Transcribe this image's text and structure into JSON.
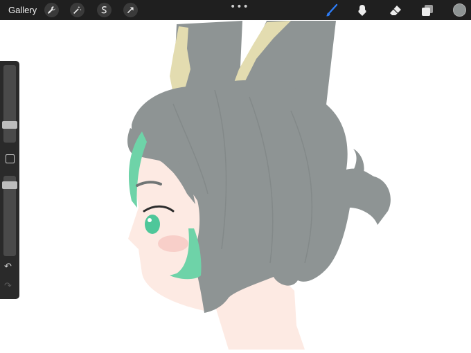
{
  "topbar": {
    "gallery_label": "Gallery",
    "more_label": "•••",
    "left_tools": [
      "wrench-icon",
      "magic-wand-icon",
      "selection-icon",
      "transform-arrow-icon"
    ],
    "right_tools": [
      "brush-icon",
      "smudge-icon",
      "eraser-icon",
      "layers-icon"
    ],
    "active_tool": "brush",
    "accent_color": "#2d7cf6",
    "current_color": "#8e9494"
  },
  "sidebar": {
    "brush_size_level": 0.2,
    "opacity_level": 0.92,
    "undo_icon": "↶",
    "redo_icon": "↷"
  },
  "artwork": {
    "description_colors": {
      "hair": "#8e9494",
      "skin": "#fdeae3",
      "green_strand": "#6ed3a8",
      "ear_inner": "#e3dcb0"
    }
  }
}
